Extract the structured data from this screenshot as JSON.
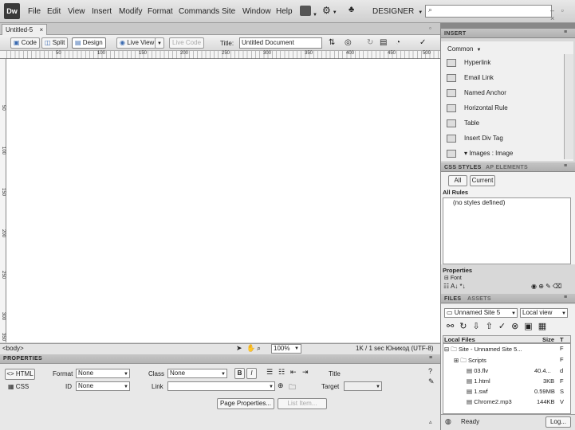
{
  "app": {
    "logo": "Dw",
    "workspace": "DESIGNER",
    "window_controls": "– ▫ ×"
  },
  "menu": [
    "File",
    "Edit",
    "View",
    "Insert",
    "Modify",
    "Format",
    "Commands",
    "Site",
    "Window",
    "Help"
  ],
  "document": {
    "tab_label": "Untitled-5",
    "tab_close": "×",
    "toolbar": {
      "code": "Code",
      "split": "Split",
      "design": "Design",
      "live_view": "Live View",
      "live_code": "Live Code",
      "title_label": "Title:",
      "title_value": "Untitled Document"
    },
    "ruler_top": [
      "50",
      "100",
      "150",
      "200",
      "250",
      "300",
      "350",
      "400",
      "450",
      "500"
    ],
    "ruler_left": [
      "50",
      "100",
      "150",
      "200",
      "250",
      "300",
      "350"
    ]
  },
  "status": {
    "tag": "<body>",
    "zoom": "100%",
    "doc_size": "1K / 1 sec  Юникод (UTF-8)"
  },
  "properties": {
    "header": "PROPERTIES",
    "html_btn": "<> HTML",
    "css_btn": "CSS",
    "format_label": "Format",
    "format_value": "None",
    "id_label": "ID",
    "id_value": "None",
    "class_label": "Class",
    "class_value": "None",
    "link_label": "Link",
    "bold": "B",
    "italic": "I",
    "title_label": "Title",
    "target_label": "Target",
    "page_properties": "Page Properties...",
    "list_item": "List Item..."
  },
  "insert_panel": {
    "tab": "INSERT",
    "category": "Common",
    "items": [
      "Hyperlink",
      "Email Link",
      "Named Anchor",
      "Horizontal Rule",
      "Table",
      "Insert Div Tag",
      "▾ Images : Image"
    ]
  },
  "css_panel": {
    "tab_css": "CSS STYLES",
    "tab_ap": "AP ELEMENTS",
    "btn_all": "All",
    "btn_current": "Current",
    "all_rules": "All Rules",
    "no_styles": "(no styles defined)",
    "properties": "Properties",
    "font_row": "Font"
  },
  "files_panel": {
    "tab_files": "FILES",
    "tab_assets": "ASSETS",
    "site_select": "Unnamed Site 5",
    "view_select": "Local view",
    "col_local": "Local Files",
    "col_size": "Size",
    "col_type": "T",
    "rows": [
      {
        "name": "Site - Unnamed Site 5...",
        "size": "",
        "type": "F"
      },
      {
        "name": "Scripts",
        "size": "",
        "type": "F"
      },
      {
        "name": "03.flv",
        "size": "40.4...",
        "type": "d"
      },
      {
        "name": "1.html",
        "size": "3KB",
        "type": "F"
      },
      {
        "name": "1.swf",
        "size": "0.59MB",
        "type": "S"
      },
      {
        "name": "Chrome2.mp3",
        "size": "144KB",
        "type": "V"
      }
    ],
    "status": "Ready",
    "log_btn": "Log..."
  }
}
